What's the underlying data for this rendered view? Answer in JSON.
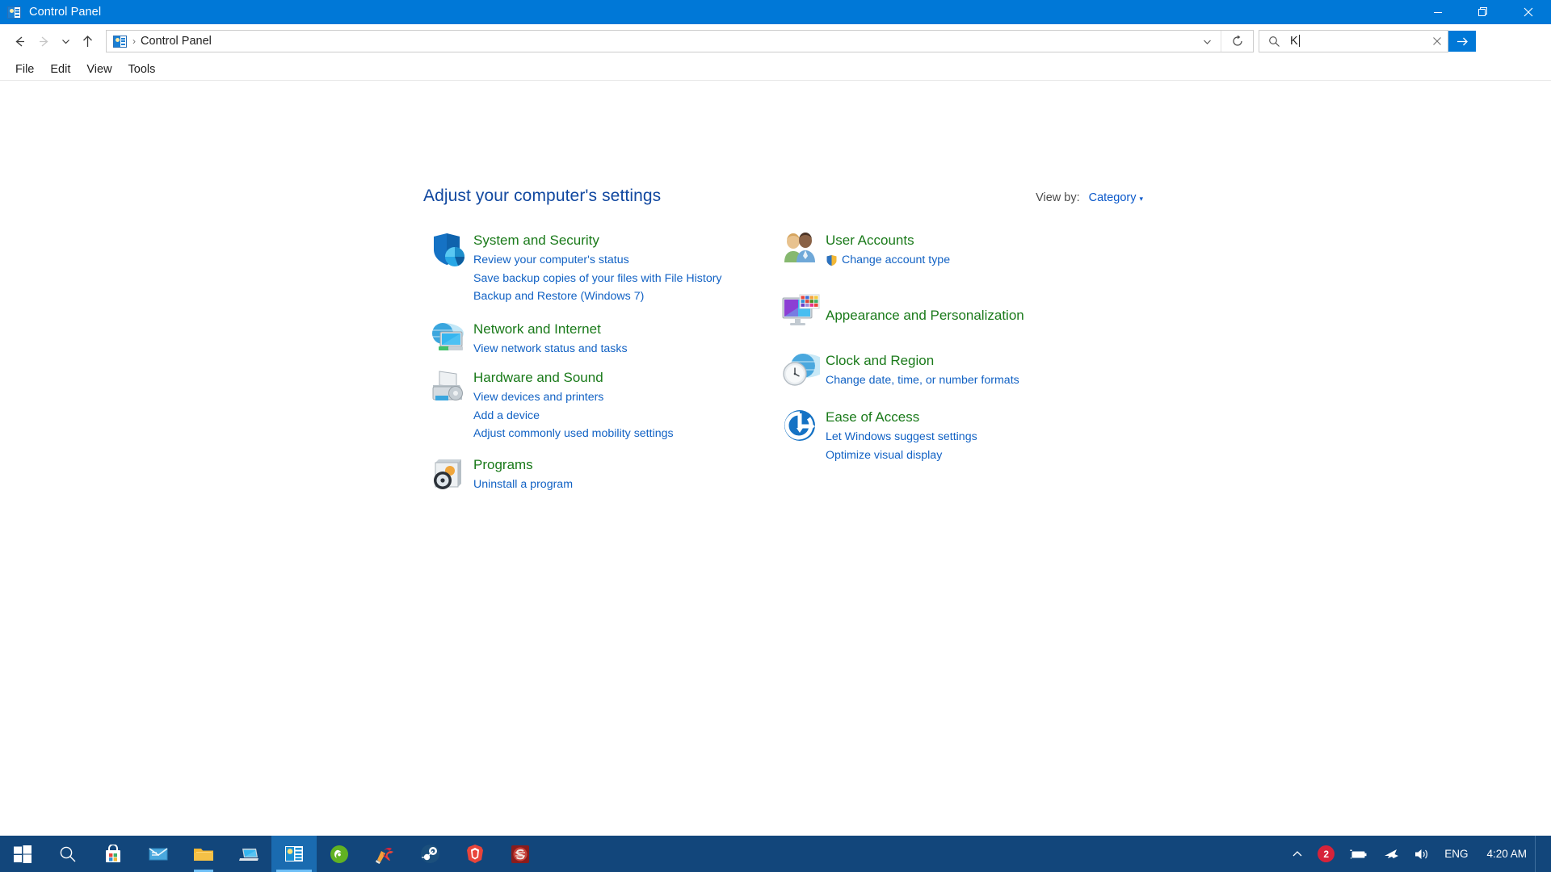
{
  "window": {
    "title": "Control Panel",
    "title_icon": "control-panel-icon",
    "minimize_label": "—",
    "restore_label": "❐",
    "close_label": "✕"
  },
  "nav": {
    "back_label": "←",
    "forward_label": "→",
    "recent_label": "⌄",
    "up_label": "↑",
    "breadcrumb_separator": "›",
    "breadcrumb": "Control Panel",
    "history_chevron": "⌄",
    "refresh_label": "↻"
  },
  "search": {
    "icon": "search-icon",
    "value": "K",
    "clear_label": "✕",
    "go_label": "→"
  },
  "menubar": {
    "items": [
      {
        "label": "File"
      },
      {
        "label": "Edit"
      },
      {
        "label": "View"
      },
      {
        "label": "Tools"
      }
    ]
  },
  "main": {
    "page_title": "Adjust your computer's settings",
    "view_by_label": "View by:",
    "view_by_value": "Category",
    "view_by_caret": "▾",
    "columns": {
      "left": [
        {
          "icon": "system-and-security-icon",
          "title": "System and Security",
          "links": [
            "Review your computer's status",
            "Save backup copies of your files with File History",
            "Backup and Restore (Windows 7)"
          ]
        },
        {
          "icon": "network-and-internet-icon",
          "title": "Network and Internet",
          "links": [
            "View network status and tasks"
          ]
        },
        {
          "icon": "hardware-and-sound-icon",
          "title": "Hardware and Sound",
          "links": [
            "View devices and printers",
            "Add a device",
            "Adjust commonly used mobility settings"
          ]
        },
        {
          "icon": "programs-icon",
          "title": "Programs",
          "links": [
            "Uninstall a program"
          ]
        }
      ],
      "right": [
        {
          "icon": "user-accounts-icon",
          "title": "User Accounts",
          "links": [
            "Change account type"
          ],
          "link_badge": "uac-shield-icon"
        },
        {
          "icon": "appearance-and-personalization-icon",
          "title": "Appearance and Personalization",
          "links": []
        },
        {
          "icon": "clock-and-region-icon",
          "title": "Clock and Region",
          "links": [
            "Change date, time, or number formats"
          ]
        },
        {
          "icon": "ease-of-access-icon",
          "title": "Ease of Access",
          "links": [
            "Let Windows suggest settings",
            "Optimize visual display"
          ]
        }
      ]
    }
  },
  "taskbar": {
    "items": [
      {
        "name": "start-button",
        "icon": "windows-logo-icon"
      },
      {
        "name": "search-button",
        "icon": "search-icon"
      },
      {
        "name": "microsoft-store-button",
        "icon": "microsoft-store-icon"
      },
      {
        "name": "mail-button",
        "icon": "mail-icon"
      },
      {
        "name": "file-explorer-button",
        "icon": "file-explorer-icon"
      },
      {
        "name": "remote-desktop-button",
        "icon": "laptop-icon"
      },
      {
        "name": "control-panel-button",
        "icon": "control-panel-icon"
      },
      {
        "name": "nvidia-button",
        "icon": "nvidia-icon"
      },
      {
        "name": "ccleaner-button",
        "icon": "ccleaner-icon"
      },
      {
        "name": "steam-button",
        "icon": "steam-icon"
      },
      {
        "name": "brave-button",
        "icon": "brave-icon"
      },
      {
        "name": "s-app-button",
        "icon": "s-logo-icon"
      }
    ],
    "tray": {
      "overflow_caret": "∧",
      "notification_count": "2",
      "battery_icon": "battery-icon",
      "airplane_icon": "airplane-mode-icon",
      "volume_icon": "volume-icon",
      "language": "ENG",
      "clock": "4:20 AM"
    }
  },
  "colors": {
    "accent": "#0078d7",
    "taskbar": "#12467b",
    "link": "#1262c4",
    "category_title": "#1a7a1a",
    "page_title": "#1148a0",
    "badge": "#d6233a"
  }
}
